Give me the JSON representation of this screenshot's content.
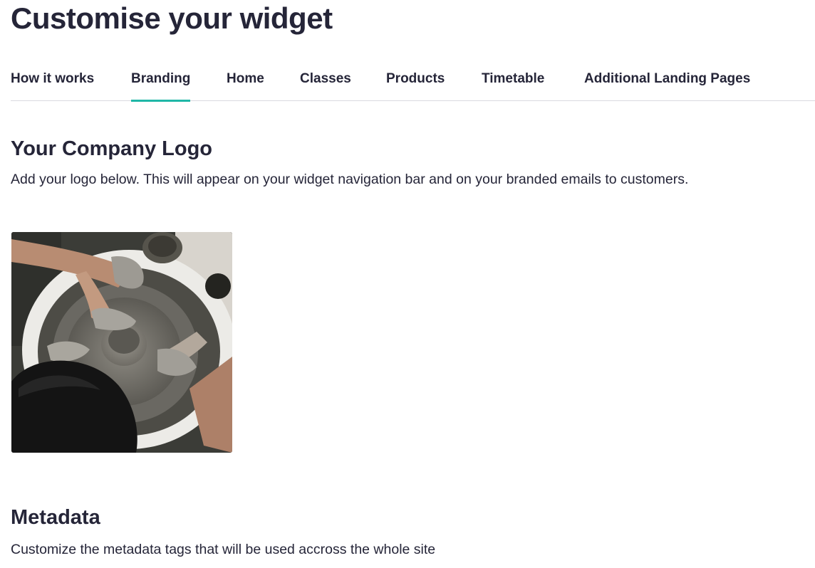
{
  "page": {
    "title": "Customise your widget"
  },
  "tabs": [
    {
      "label": "How it works",
      "active": false
    },
    {
      "label": "Branding",
      "active": true
    },
    {
      "label": "Home",
      "active": false
    },
    {
      "label": "Classes",
      "active": false
    },
    {
      "label": "Products",
      "active": false
    },
    {
      "label": "Timetable",
      "active": false
    },
    {
      "label": "Additional Landing Pages",
      "active": false
    }
  ],
  "colors": {
    "text": "#252538",
    "accent": "#1fb7a7",
    "divider": "#d9dadf"
  },
  "logo_section": {
    "title": "Your Company Logo",
    "description": "Add your logo below. This will appear on your widget navigation bar and on your branded emails to customers.",
    "image": "pottery-wheel-photo"
  },
  "metadata_section": {
    "title": "Metadata",
    "description": "Customize the metadata tags that will be used accross the whole site"
  }
}
